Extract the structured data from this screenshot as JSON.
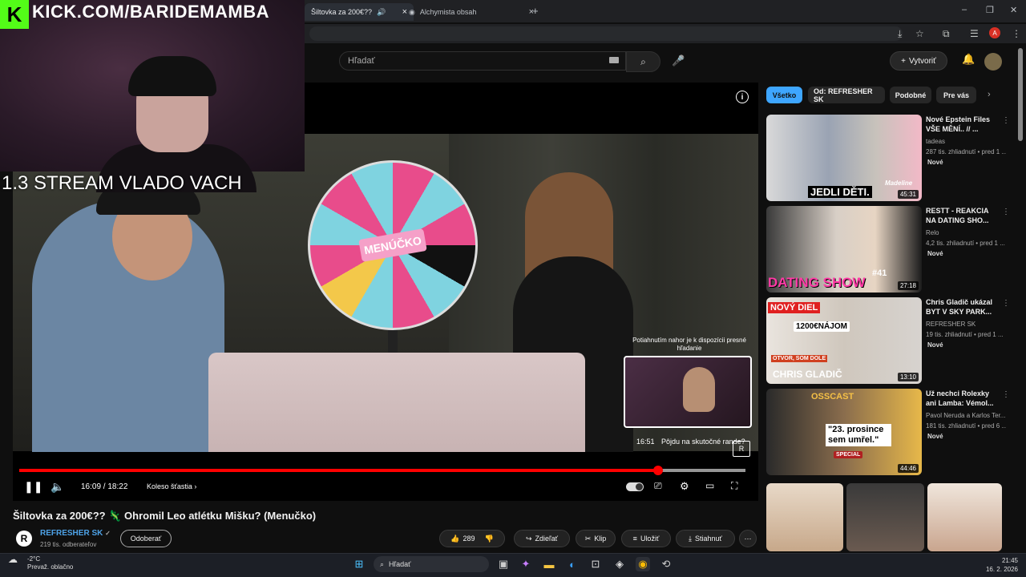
{
  "browser": {
    "tabs": [
      {
        "label": "Šiltovka za 200€??",
        "active": true
      },
      {
        "label": "Alchymista obsah",
        "active": false
      }
    ],
    "new_tab_icon": "plus-icon",
    "window_controls": [
      "minimize-icon",
      "restore-icon",
      "close-icon"
    ],
    "profile_initial": "A"
  },
  "overlay": {
    "kick_logo": "K",
    "kick_url": "KICK.COM/BARIDEMAMBA",
    "stream_title": "1.3 STREAM VLADO VACH"
  },
  "youtube": {
    "search_placeholder": "Hľadať",
    "create_label": "Vytvoriť",
    "player": {
      "wheel_label": "MENÚČKO",
      "current_time": "16:09",
      "duration": "18:22",
      "time_text": "16:09 / 18:22",
      "progress_fraction": 0.88,
      "chapter": "Koleso šťastia",
      "chapter_arrow": "›",
      "hint": "Potiahnutím nahor je k dispozícii presné hľadanie",
      "preview_time": "16:51",
      "preview_caption": "Pôjdu na skutočné rande?"
    },
    "video": {
      "title": "Šiltovka za 200€?? 🦎 Ohromil Leo atlétku Mišku? (Menučko)",
      "channel": "REFRESHER SK",
      "channel_badge": "✓",
      "subscribers": "219 tis. odberateľov",
      "unsubscribe": "Odoberať",
      "likes": "289",
      "share": "Zdieľať",
      "clip": "Klip",
      "save": "Uložiť",
      "download": "Stiahnuť"
    },
    "chips": [
      "Všetko",
      "Od: REFRESHER SK",
      "Podobné",
      "Pre vás"
    ],
    "recommendations": [
      {
        "title": "Nové Epstein Files VŠE MĚNÍ.. // ...",
        "channel": "tadeas",
        "meta": "287 tis. zhliadnutí • pred 1 ...",
        "badge": "Nové",
        "duration": "45:31",
        "thumb_text": "JEDLI DĚTI.",
        "thumb_text2": "Madeline"
      },
      {
        "title": "RESTT - REAKCIA NA DATING SHO...",
        "channel": "Relo",
        "meta": "4,2 tis. zhliadnutí • pred 1 ...",
        "badge": "Nové",
        "duration": "27:18",
        "thumb_text": "DATING SHOW",
        "thumb_text2": "#41"
      },
      {
        "title": "Chris Gladič ukázal BYT V SKY PARK...",
        "channel": "REFRESHER SK",
        "meta": "19 tis. zhliadnutí • pred 1 ...",
        "badge": "Nové",
        "duration": "13:10",
        "thumb_text": "CHRIS GLADIČ",
        "thumb_text2": "NOVÝ DIEL",
        "thumb_text3": "1200€NÁJOM",
        "thumb_text4": "OTVOR, SOM DOLE"
      },
      {
        "title": "Už nechci Rolexky ani Lamba: Vémol...",
        "channel": "Pavol Neruda a Karlos Ter...",
        "meta": "181 tis. zhliadnutí • pred 6 ...",
        "badge": "Nové",
        "duration": "44:46",
        "thumb_text": "\"23. prosince sem umřel.\"",
        "thumb_text2": "OSSCAST",
        "thumb_text3": "SPECIAL"
      }
    ]
  },
  "taskbar": {
    "weather_temp": "-2°C",
    "weather_desc": "Prevaž. oblačno",
    "search": "Hľadať",
    "time": "21:45",
    "date": "16. 2. 2026"
  },
  "colors": {
    "accent_blue": "#3ea6ff",
    "progress_red": "#ff0000",
    "kick_green": "#53fc18",
    "chip_active": "#3ea6ff"
  }
}
